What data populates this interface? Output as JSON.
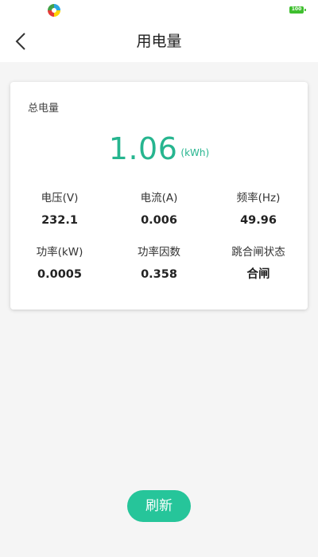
{
  "status_bar": {
    "battery": "100",
    "icons": [
      "app-icon",
      "battery-icon"
    ]
  },
  "header": {
    "title": "用电量",
    "back_icon": "back-chevron-icon"
  },
  "card": {
    "label": "总电量",
    "total_value": "1.06",
    "total_unit": "(kWh)",
    "metrics": [
      {
        "label": "电压(V)",
        "value": "232.1"
      },
      {
        "label": "电流(A)",
        "value": "0.006"
      },
      {
        "label": "频率(Hz)",
        "value": "49.96"
      },
      {
        "label": "功率(kW)",
        "value": "0.0005"
      },
      {
        "label": "功率因数",
        "value": "0.358"
      },
      {
        "label": "跳合闸状态",
        "value": "合闸"
      }
    ]
  },
  "actions": {
    "refresh_label": "刷新"
  },
  "colors": {
    "accent": "#26b58f",
    "button": "#26c59a",
    "battery": "#3fbf2f"
  }
}
